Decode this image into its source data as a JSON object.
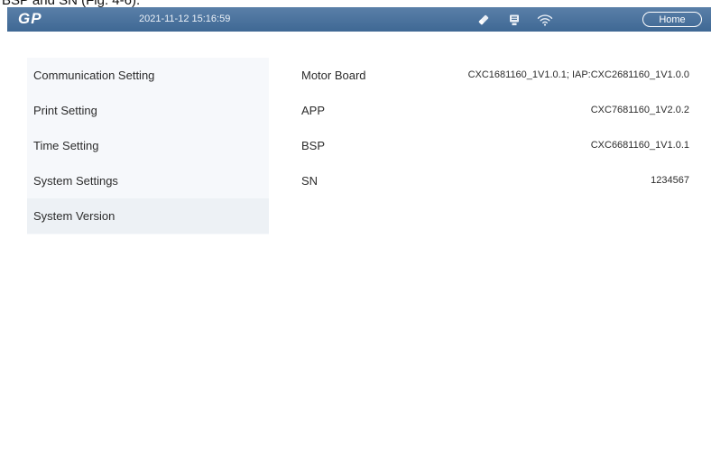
{
  "caption": {
    "text": "BSP and SN (Fig. 4-6)."
  },
  "topbar": {
    "logo": "GP",
    "datetime": "2021-11-12 15:16:59",
    "icons": [
      "eraser-icon",
      "printer-icon",
      "wifi-icon"
    ],
    "home_label": "Home",
    "colors": {
      "bar": "#4a7099",
      "text": "#ffffff"
    }
  },
  "menu": {
    "items": [
      {
        "label": "Communication Setting",
        "active": false
      },
      {
        "label": "Print Setting",
        "active": false
      },
      {
        "label": "Time Setting",
        "active": false
      },
      {
        "label": "System Settings",
        "active": false
      },
      {
        "label": "System Version",
        "active": true
      }
    ]
  },
  "version_info": {
    "rows": [
      {
        "label": "Motor Board",
        "value": "CXC1681160_1V1.0.1; IAP:CXC2681160_1V1.0.0"
      },
      {
        "label": "APP",
        "value": "CXC7681160_1V2.0.2"
      },
      {
        "label": "BSP",
        "value": "CXC6681160_1V1.0.1"
      },
      {
        "label": "SN",
        "value": "1234567"
      }
    ]
  }
}
